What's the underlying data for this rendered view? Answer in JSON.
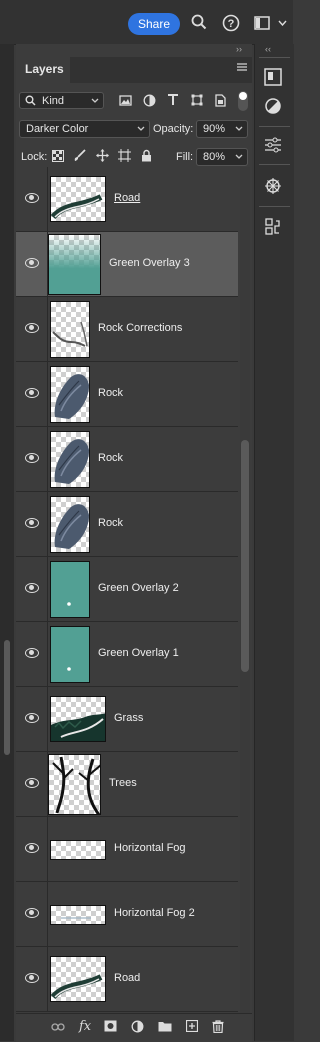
{
  "topbar": {
    "share_label": "Share",
    "icons": [
      "search-icon",
      "help-icon",
      "workspace-icon",
      "chevron-down-icon"
    ]
  },
  "panel": {
    "tab_label": "Layers",
    "filter": {
      "kind_label": "Kind",
      "filter_icons": [
        "image-filter-icon",
        "adjustment-filter-icon",
        "type-filter-icon",
        "shape-filter-icon",
        "smart-object-filter-icon",
        "filter-toggle"
      ]
    },
    "blend_mode": "Darker Color",
    "opacity_label": "Opacity:",
    "opacity_value": "90%",
    "lock_label": "Lock:",
    "fill_label": "Fill:",
    "fill_value": "80%"
  },
  "layers": [
    {
      "name": "Road",
      "thumb": "road",
      "selected": false,
      "underlined": true
    },
    {
      "name": "Green Overlay 3",
      "thumb": "green-fade",
      "selected": true
    },
    {
      "name": "Rock Corrections",
      "thumb": "rock-corrections",
      "selected": false
    },
    {
      "name": "Rock",
      "thumb": "rock",
      "selected": false
    },
    {
      "name": "Rock",
      "thumb": "rock",
      "selected": false
    },
    {
      "name": "Rock",
      "thumb": "rock",
      "selected": false
    },
    {
      "name": "Green Overlay 2",
      "thumb": "teal",
      "selected": false
    },
    {
      "name": "Green Overlay 1",
      "thumb": "teal",
      "selected": false
    },
    {
      "name": "Grass",
      "thumb": "grass",
      "selected": false
    },
    {
      "name": "Trees",
      "thumb": "trees",
      "selected": false
    },
    {
      "name": "Horizontal Fog",
      "thumb": "fog",
      "selected": false
    },
    {
      "name": "Horizontal Fog 2",
      "thumb": "fog2",
      "selected": false
    },
    {
      "name": "Road",
      "thumb": "road",
      "selected": false
    }
  ],
  "bottom_bar": {
    "icons": [
      "link-layers-icon",
      "fx-icon",
      "add-mask-icon",
      "adjustment-layer-icon",
      "group-folder-icon",
      "new-layer-icon",
      "delete-icon"
    ],
    "fx_label": "fx"
  },
  "dock": {
    "icons": [
      "libraries-icon",
      "adjustments-icon",
      "properties-icon",
      "navigator-icon",
      "history-icon"
    ]
  },
  "colors": {
    "accent": "#2f74e0",
    "selected_row": "#5c5c5c",
    "teal": "#52a094"
  }
}
